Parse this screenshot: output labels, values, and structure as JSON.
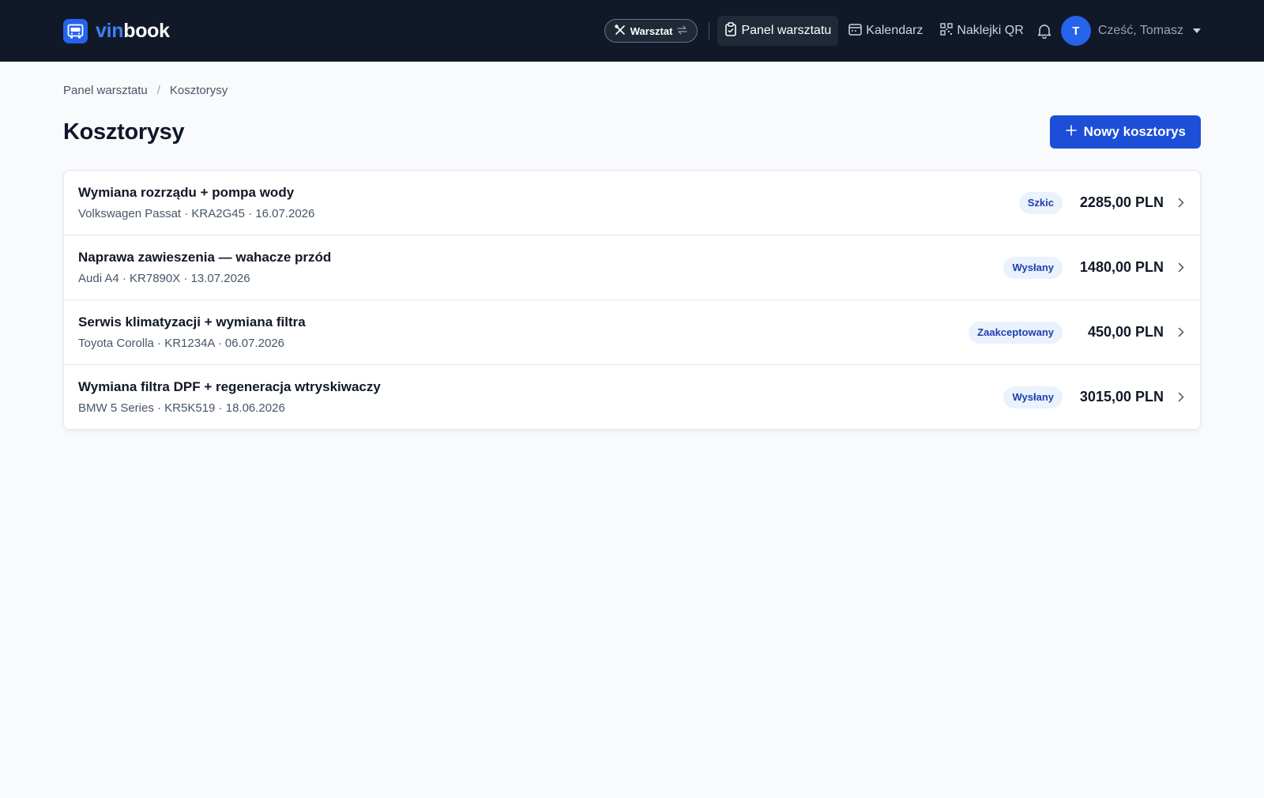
{
  "brand": {
    "prefix": "vin",
    "suffix": "book"
  },
  "nav": {
    "mode_label": "Warsztat",
    "links": [
      {
        "label": "Panel warsztatu",
        "icon": "clipboard-icon"
      },
      {
        "label": "Kalendarz",
        "icon": "calendar-icon"
      },
      {
        "label": "Naklejki QR",
        "icon": "qr-icon"
      }
    ],
    "avatar_initial": "T",
    "greeting": "Cześć, Tomasz"
  },
  "breadcrumb": {
    "parent": "Panel warsztatu",
    "separator": "/",
    "current": "Kosztorysy"
  },
  "page": {
    "title": "Kosztorysy",
    "new_button_label": "Nowy kosztorys"
  },
  "estimates": [
    {
      "title": "Wymiana rozrządu + pompa wody",
      "meta": "Volkswagen Passat · KRA2G45 · 16.07.2026",
      "status": "Szkic",
      "amount": "2285,00 PLN"
    },
    {
      "title": "Naprawa zawieszenia — wahacze przód",
      "meta": "Audi A4 · KR7890X · 13.07.2026",
      "status": "Wysłany",
      "amount": "1480,00 PLN"
    },
    {
      "title": "Serwis klimatyzacji + wymiana filtra",
      "meta": "Toyota Corolla · KR1234A · 06.07.2026",
      "status": "Zaakceptowany",
      "amount": "450,00 PLN"
    },
    {
      "title": "Wymiana filtra DPF + regeneracja wtryskiwaczy",
      "meta": "BMW 5 Series · KR5K519 · 18.06.2026",
      "status": "Wysłany",
      "amount": "3015,00 PLN"
    }
  ],
  "colors": {
    "topbar": "#111827",
    "accent": "#1d4ed8",
    "badge_bg": "#eaf2fd",
    "badge_text": "#1e40af"
  }
}
